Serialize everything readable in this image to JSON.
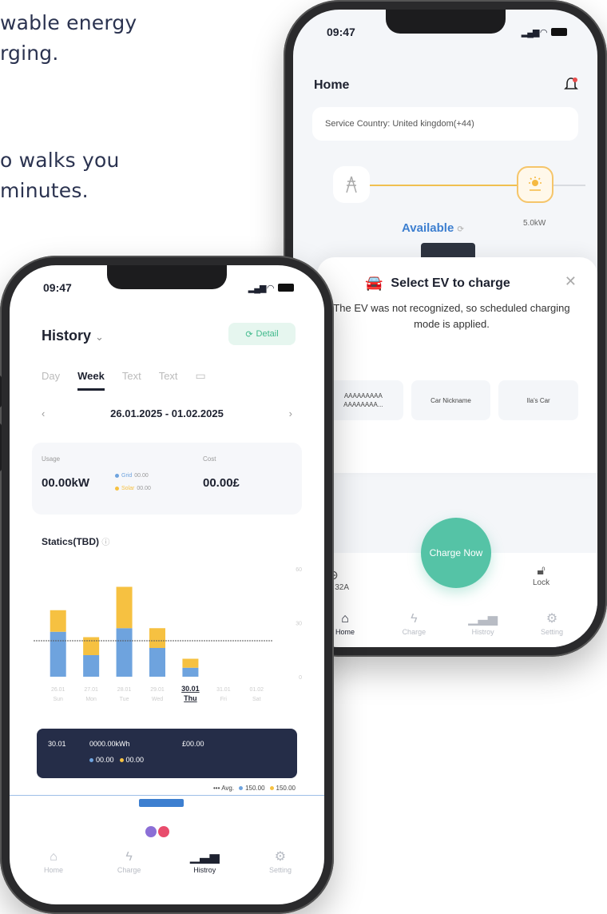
{
  "background_text": {
    "line1": "wable energy",
    "line1b": "rging.",
    "line2": "o walks you",
    "line2b": " minutes."
  },
  "home_phone": {
    "time": "09:47",
    "title": "Home",
    "service_country": "Service Country: United kingdom(+44)",
    "status": "Available",
    "solar_power": "5.0kW",
    "ev_sheet": {
      "title": "Select EV to charge",
      "message": "The EV was not recognized, so scheduled charging mode is applied.",
      "cards": [
        "AAAAAAAAA AAAAAAAA...",
        "Car Nickname",
        "Ila's Car"
      ]
    },
    "charge_button": "Charge Now",
    "speed_label": "eed: 32A",
    "lock_label": "Lock",
    "tabs": [
      {
        "label": "Home",
        "icon": "home-icon"
      },
      {
        "label": "Charge",
        "icon": "bolt-icon"
      },
      {
        "label": "Histroy",
        "icon": "bar-chart-icon"
      },
      {
        "label": "Setting",
        "icon": "gear-icon"
      }
    ]
  },
  "history_phone": {
    "time": "09:47",
    "title": "History",
    "detail_button": "Detail",
    "periods": [
      "Day",
      "Week",
      "Text",
      "Text"
    ],
    "selected_period": "Week",
    "date_range": "26.01.2025 - 01.02.2025",
    "usage": {
      "usage_label": "Usage",
      "usage_value": "00.00kW",
      "grid_label": "Grid",
      "grid_value": "00.00",
      "solar_label": "Solar",
      "solar_value": "00.00",
      "cost_label": "Cost",
      "cost_value": "00.00£"
    },
    "statics_label": "Statics(TBD)",
    "tooltip": {
      "date": "30.01",
      "energy": "0000.00kWh",
      "cost": "£00.00",
      "grid": "00.00",
      "solar": "00.00"
    },
    "avg": {
      "label": "Avg.",
      "grid": "150.00",
      "solar": "150.00"
    },
    "tabs": [
      {
        "label": "Home",
        "icon": "home-icon"
      },
      {
        "label": "Charge",
        "icon": "bolt-icon"
      },
      {
        "label": "Histroy",
        "icon": "bar-chart-icon"
      },
      {
        "label": "Setting",
        "icon": "gear-icon"
      }
    ]
  },
  "chart_data": {
    "type": "bar",
    "categories": [
      "26.01 Sun",
      "27.01 Mon",
      "28.01 Tue",
      "29.01 Wed",
      "30.01 Thu",
      "31.01 Fri",
      "01.02 Sat"
    ],
    "day_nums": [
      "26.01",
      "27.01",
      "28.01",
      "29.01",
      "30.01",
      "31.01",
      "01.02"
    ],
    "day_names": [
      "Sun",
      "Mon",
      "Tue",
      "Wed",
      "Thu",
      "Fri",
      "Sat"
    ],
    "selected_index": 4,
    "series": [
      {
        "name": "Grid",
        "color": "#6ea3de",
        "values": [
          25,
          12,
          27,
          16,
          5,
          0,
          0
        ]
      },
      {
        "name": "Solar",
        "color": "#f6c141",
        "values": [
          12,
          10,
          23,
          11,
          5,
          0,
          0
        ]
      }
    ],
    "ylim": [
      0,
      60
    ],
    "yticks": [
      "60",
      "30",
      "0"
    ],
    "avg_line": 20,
    "colors": {
      "grid": "#6ea3de",
      "solar": "#f6c141",
      "accent": "#55c3a6"
    }
  }
}
